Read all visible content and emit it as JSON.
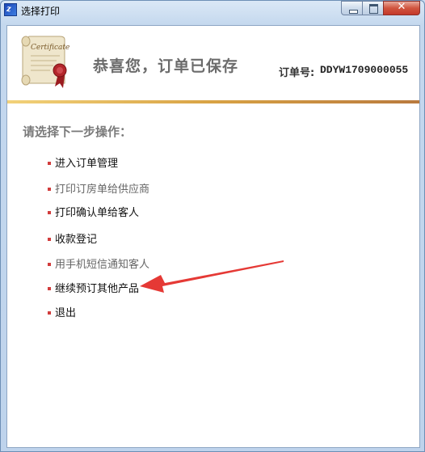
{
  "window": {
    "title": "选择打印"
  },
  "header": {
    "heading": "恭喜您，订单已保存",
    "order_label": "订单号:",
    "order_number": "DDYW1709000055",
    "certificate_text": "Certificate"
  },
  "main": {
    "prompt": "请选择下一步操作：",
    "options": [
      {
        "label": "进入订单管理",
        "style": "black"
      },
      {
        "label": "打印订房单给供应商",
        "style": "gray"
      },
      {
        "label": "打印确认单给客人",
        "style": "black"
      },
      {
        "label": "收款登记",
        "style": "black"
      },
      {
        "label": "用手机短信通知客人",
        "style": "gray"
      },
      {
        "label": "继续预订其他产品",
        "style": "black"
      },
      {
        "label": "退出",
        "style": "black"
      }
    ]
  },
  "colors": {
    "bullet": "#d23c3c",
    "arrow": "#e53935",
    "divider_start": "#f2d27a",
    "divider_end": "#b97a3e"
  },
  "icons": [
    "app-icon",
    "certificate-icon",
    "minimize-icon",
    "maximize-icon",
    "close-icon",
    "arrow-annotation"
  ]
}
